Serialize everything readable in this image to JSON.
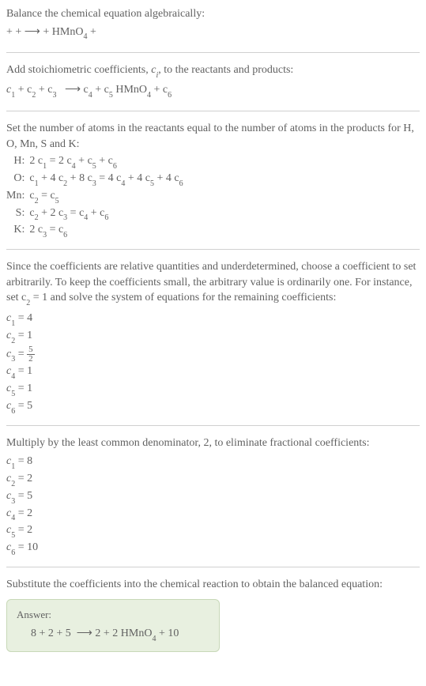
{
  "chart_data": {
    "type": "table",
    "title": "Balance the chemical equation algebraically",
    "atom_equations": [
      {
        "atom": "H",
        "equation": "2c1 = 2c4 + c5 + c6"
      },
      {
        "atom": "O",
        "equation": "c1 + 4c2 + 8c3 = 4c4 + 4c5 + 4c6"
      },
      {
        "atom": "Mn",
        "equation": "c2 = c5"
      },
      {
        "atom": "S",
        "equation": "c2 + 2c3 = c4 + c6"
      },
      {
        "atom": "K",
        "equation": "2c3 = c6"
      }
    ],
    "initial_solution": {
      "c1": 4,
      "c2": 1,
      "c3": "5/2",
      "c4": 1,
      "c5": 1,
      "c6": 5
    },
    "final_solution": {
      "c1": 8,
      "c2": 2,
      "c3": 5,
      "c4": 2,
      "c5": 2,
      "c6": 10
    },
    "balanced_equation": "8 + 2 + 5 ⟶ 2 + 2 HMnO4 + 10"
  },
  "s1": {
    "line1": "Balance the chemical equation algebraically:",
    "line2a": " +  + ",
    "line2b": "  +  HMnO",
    "line2b_sub": "4",
    "line2c": " + "
  },
  "s2": {
    "line1a": "Add stoichiometric coefficients, ",
    "line1b": "c",
    "line1c": "i",
    "line1d": ", to the reactants and products:",
    "line2": {
      "p1": "c",
      "s1": "1",
      "p2": "  + c",
      "s2": "2",
      "p3": "  + c",
      "s3": "3",
      "p4": " c",
      "s4": "4",
      "p5": "  + c",
      "s5": "5",
      "p6": " HMnO",
      "s6": "4",
      "p7": " + c",
      "s7": "6"
    }
  },
  "s3": {
    "line1": "Set the number of atoms in the reactants equal to the number of atoms in the products for H, O, Mn, S and K:",
    "rows": [
      {
        "atom": "H:",
        "lhs_pre": "2 c",
        "lhs_sub": "1",
        "rhs": " = 2 c4 + c5 + c6",
        "parts": [
          " = 2 c",
          "4",
          " + c",
          "5",
          " + c",
          "6"
        ]
      },
      {
        "atom": "O:",
        "lhs_pre": "c",
        "lhs_sub": "1",
        "parts": [
          " + 4 c",
          "2",
          " + 8 c",
          "3",
          " = 4 c",
          "4",
          " + 4 c",
          "5",
          " + 4 c",
          "6"
        ]
      },
      {
        "atom": "Mn:",
        "lhs_pre": "c",
        "lhs_sub": "2",
        "parts": [
          " = c",
          "5"
        ]
      },
      {
        "atom": "S:",
        "lhs_pre": "c",
        "lhs_sub": "2",
        "parts": [
          " + 2 c",
          "3",
          " = c",
          "4",
          " + c",
          "6"
        ]
      },
      {
        "atom": "K:",
        "lhs_pre": "2 c",
        "lhs_sub": "3",
        "parts": [
          " = c",
          "6"
        ]
      }
    ]
  },
  "s4": {
    "line1a": "Since the coefficients are relative quantities and underdetermined, choose a coefficient to set arbitrarily. To keep the coefficients small, the arbitrary value is ordinarily one. For instance, set c",
    "line1b": "2",
    "line1c": " = 1 and solve the system of equations for the remaining coefficients:",
    "sol": [
      {
        "c": "c",
        "i": "1",
        "v": " = 4"
      },
      {
        "c": "c",
        "i": "2",
        "v": " = 1"
      },
      {
        "c": "c",
        "i": "3",
        "frac_num": "5",
        "frac_den": "2"
      },
      {
        "c": "c",
        "i": "4",
        "v": " = 1"
      },
      {
        "c": "c",
        "i": "5",
        "v": " = 1"
      },
      {
        "c": "c",
        "i": "6",
        "v": " = 5"
      }
    ]
  },
  "s5": {
    "line1": "Multiply by the least common denominator, 2, to eliminate fractional coefficients:",
    "sol": [
      {
        "c": "c",
        "i": "1",
        "v": " = 8"
      },
      {
        "c": "c",
        "i": "2",
        "v": " = 2"
      },
      {
        "c": "c",
        "i": "3",
        "v": " = 5"
      },
      {
        "c": "c",
        "i": "4",
        "v": " = 2"
      },
      {
        "c": "c",
        "i": "5",
        "v": " = 2"
      },
      {
        "c": "c",
        "i": "6",
        "v": " = 10"
      }
    ]
  },
  "s6": {
    "line1": "Substitute the coefficients into the chemical reaction to obtain the balanced equation:",
    "answer_label": "Answer:",
    "eq": {
      "p1": "8  + 2  + 5 ",
      "p2": " 2  + 2 HMnO",
      "sub": "4",
      "p3": " + 10"
    }
  },
  "arrow": "⟶"
}
